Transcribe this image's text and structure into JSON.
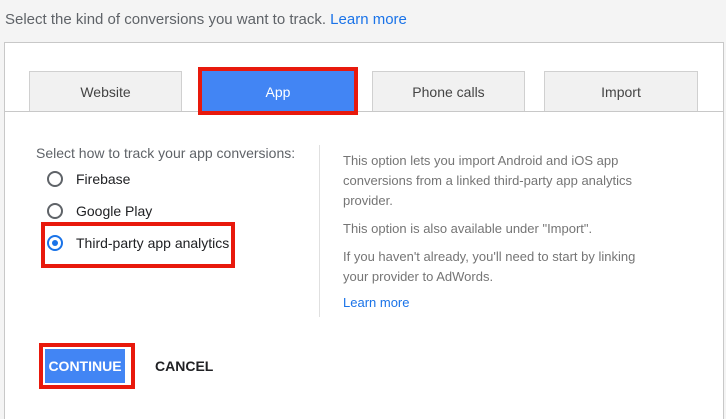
{
  "intro": {
    "text": "Select the kind of conversions you want to track.",
    "learn_more": "Learn more"
  },
  "tabs": [
    {
      "label": "Website",
      "active": false
    },
    {
      "label": "App",
      "active": true
    },
    {
      "label": "Phone calls",
      "active": false
    },
    {
      "label": "Import",
      "active": false
    }
  ],
  "app_panel": {
    "prompt": "Select how to track your app conversions:",
    "options": [
      {
        "label": "Firebase",
        "selected": false
      },
      {
        "label": "Google Play",
        "selected": false
      },
      {
        "label": "Third-party app analytics",
        "selected": true
      }
    ],
    "info": {
      "paragraph_1": "This option lets you import Android and iOS app conversions from a linked third-party app analytics provider.",
      "paragraph_2": "This option is also available under \"Import\".",
      "paragraph_3": "If you haven't already, you'll need to start by linking your provider to AdWords.",
      "learn_more": "Learn more"
    }
  },
  "actions": {
    "continue_label": "CONTINUE",
    "cancel_label": "CANCEL"
  },
  "colors": {
    "accent_blue": "#4285f4",
    "link_blue": "#1a73e8",
    "highlight_red": "#e8190c"
  }
}
